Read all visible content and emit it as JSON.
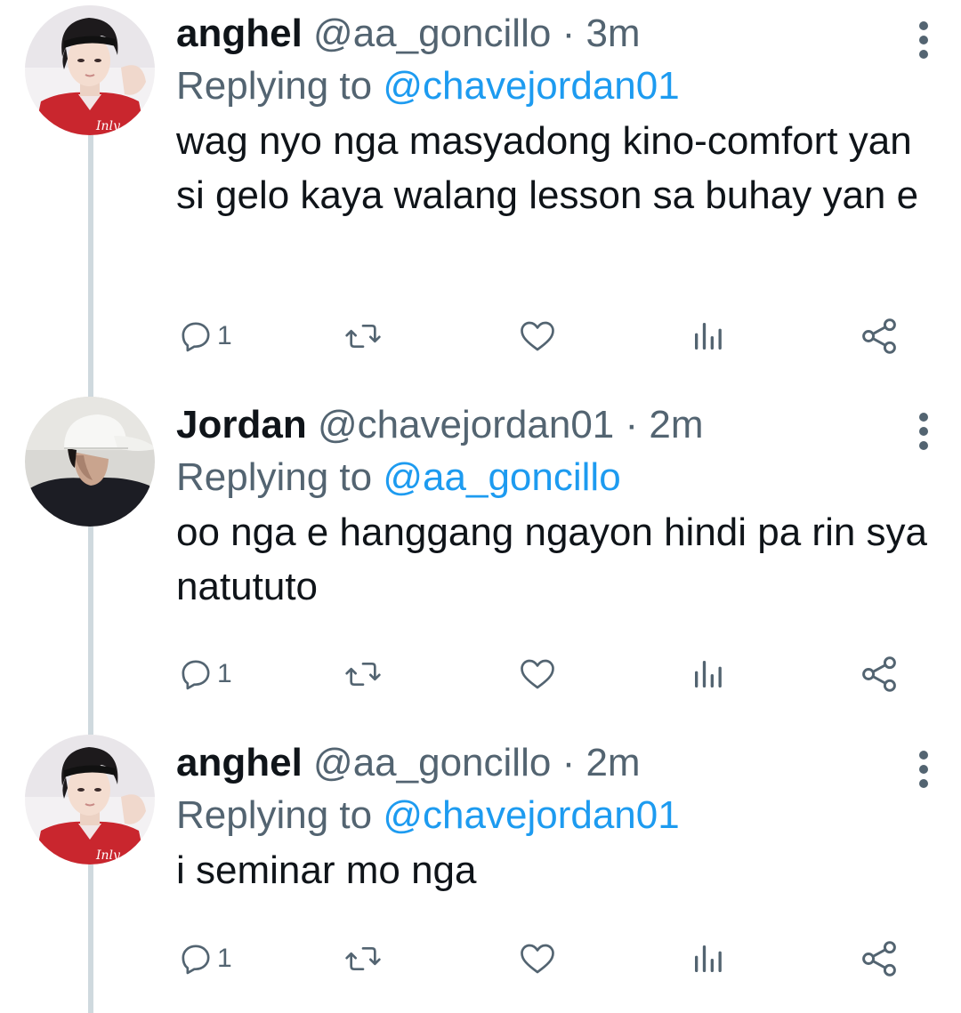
{
  "tweets": [
    {
      "display_name": "anghel",
      "handle": "@aa_goncillo",
      "time": "3m",
      "replying_prefix": "Replying to",
      "replying_to": "@chavejordan01",
      "text": "wag nyo nga masyadong kino-comfort yan si gelo kaya walang lesson sa buhay yan e",
      "reply_count": "1",
      "avatar": "avatar-headband"
    },
    {
      "display_name": "Jordan",
      "handle": "@chavejordan01",
      "time": "2m",
      "replying_prefix": "Replying to",
      "replying_to": "@aa_goncillo",
      "text": "oo nga e hanggang ngayon hindi pa rin sya natututo",
      "reply_count": "1",
      "avatar": "avatar-white-cap"
    },
    {
      "display_name": "anghel",
      "handle": "@aa_goncillo",
      "time": "2m",
      "replying_prefix": "Replying to",
      "replying_to": "@chavejordan01",
      "text": "i seminar mo nga",
      "reply_count": "1",
      "avatar": "avatar-headband"
    }
  ],
  "header_separator": "·",
  "colors": {
    "text_primary": "#0f1419",
    "text_secondary": "#536471",
    "link": "#1d9bf0",
    "thread_line": "#cfd9de"
  },
  "icons": [
    "reply-icon",
    "retweet-icon",
    "like-icon",
    "views-icon",
    "share-icon",
    "more-options-icon"
  ]
}
